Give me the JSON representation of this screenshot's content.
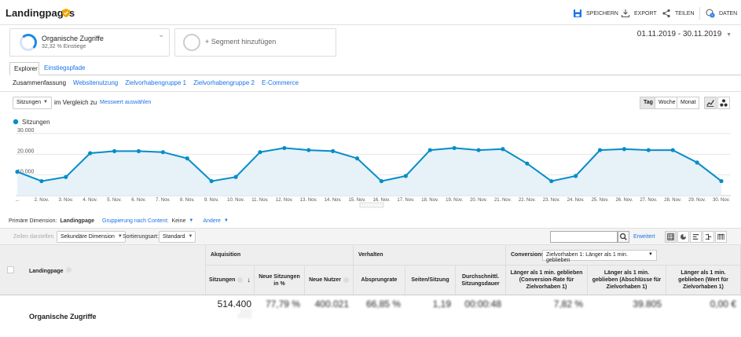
{
  "header": {
    "title": "Landingpages",
    "actions": [
      {
        "label": "SPEICHERN",
        "icon": "save-icon"
      },
      {
        "label": "EXPORT",
        "icon": "export-icon"
      },
      {
        "label": "TEILEN",
        "icon": "share-icon"
      },
      {
        "label": "DATEN",
        "icon": "insights-icon"
      }
    ]
  },
  "segments": {
    "segment1": {
      "name": "Organische Zugriffe",
      "sub": "32,32 % Einstiege"
    },
    "segment2": {
      "label": "+ Segment hinzufügen"
    }
  },
  "date_range": "01.11.2019 - 30.11.2019",
  "tabs": [
    "Explorer",
    "Einstiegspfade"
  ],
  "subtabs": [
    "Zusammenfassung",
    "Websitenutzung",
    "Zielvorhabengruppe 1",
    "Zielvorhabengruppe 2",
    "E-Commerce"
  ],
  "metric_controls": {
    "metric": "Sitzungen",
    "compare": "im Vergleich zu",
    "select_metric": "Messwert auswählen",
    "granularity": [
      "Tag",
      "Woche",
      "Monat"
    ]
  },
  "chart_data": {
    "type": "area",
    "series": [
      {
        "name": "Sitzungen",
        "values": [
          11500,
          7000,
          9000,
          20500,
          21500,
          21500,
          21000,
          18000,
          7000,
          9000,
          21000,
          23000,
          22000,
          21500,
          18000,
          7000,
          9500,
          22000,
          23000,
          22000,
          22500,
          15500,
          7000,
          9500,
          22000,
          22500,
          22000,
          22000,
          16000,
          7000
        ]
      }
    ],
    "x": [
      "1. Nov.",
      "2. Nov.",
      "3. Nov.",
      "4. Nov.",
      "5. Nov.",
      "6. Nov.",
      "7. Nov.",
      "8. Nov.",
      "9. Nov.",
      "10. Nov.",
      "11. Nov.",
      "12. Nov.",
      "13. Nov.",
      "14. Nov.",
      "15. Nov.",
      "16. Nov.",
      "17. Nov.",
      "18. Nov.",
      "19. Nov.",
      "20. Nov.",
      "21. Nov.",
      "22. Nov.",
      "23. Nov.",
      "24. Nov.",
      "25. Nov.",
      "26. Nov.",
      "27. Nov.",
      "28. Nov.",
      "29. Nov.",
      "30. Nov."
    ],
    "x_tick_labels": [
      "...",
      "2. Nov.",
      "3. Nov.",
      "4. Nov.",
      "5. Nov.",
      "6. Nov.",
      "7. Nov.",
      "8. Nov.",
      "9. Nov.",
      "10. Nov.",
      "11. Nov.",
      "12. Nov.",
      "13. Nov.",
      "14. Nov.",
      "15. Nov.",
      "16. Nov.",
      "17. Nov.",
      "18. Nov.",
      "19. Nov.",
      "20. Nov.",
      "21. Nov.",
      "22. Nov.",
      "23. Nov.",
      "24. Nov.",
      "25. Nov.",
      "26. Nov.",
      "27. Nov.",
      "28. Nov.",
      "29. Nov.",
      "30. Nov."
    ],
    "y_ticks": [
      "30.000",
      "20.000",
      "10.000"
    ],
    "ylim": [
      0,
      30000
    ],
    "grid": true,
    "legend": "top-left",
    "color": "#058dc7"
  },
  "primary_dimension": {
    "label": "Primäre Dimension:",
    "value": "Landingpage",
    "group": "Gruppierung nach Content:",
    "group_value": "Keine",
    "other": "Andere"
  },
  "toolbar": {
    "rows_plot": "Zeilen darstellen",
    "secondary_dim": "Sekundäre Dimension",
    "sort_label": "Sortierungsart:",
    "sort_value": "Standard",
    "advanced": "Erweitert"
  },
  "table": {
    "dim_header": "Landingpage",
    "groups": {
      "acquisition": "Akquisition",
      "behavior": "Verhalten",
      "conversions": "Conversions"
    },
    "conv_select": "Zielvorhaben 1: Länger als 1 min. geblieben",
    "columns": [
      "Sitzungen",
      "Neue Sitzungen in %",
      "Neue Nutzer",
      "Absprungrate",
      "Seiten/Sitzung",
      "Durchschnittl. Sitzungsdauer",
      "Länger als 1 min. geblieben (Conversion-Rate für Zielvorhaben 1)",
      "Länger als 1 min. geblieben (Abschlüsse für Zielvorhaben 1)",
      "Länger als 1 min. geblieben (Wert für Zielvorhaben 1)"
    ],
    "row": {
      "label": "Organische Zugriffe",
      "values": [
        "514.400",
        "77,79 %",
        "400.021",
        "66,85 %",
        "1,19",
        "00:00:48",
        "7,82 %",
        "39.805",
        "0,00 €"
      ]
    }
  }
}
